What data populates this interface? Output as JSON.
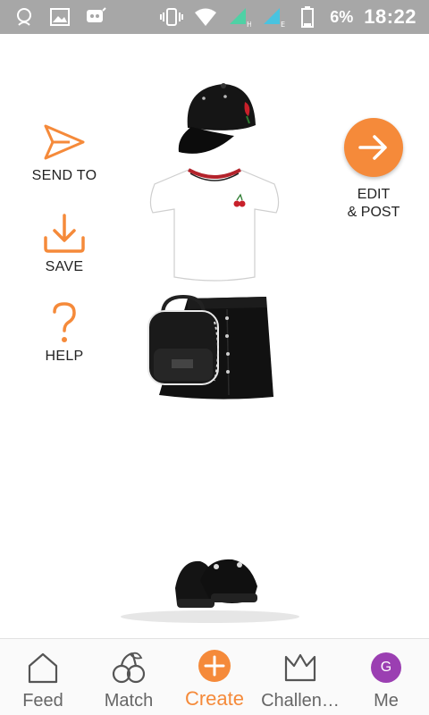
{
  "status_bar": {
    "battery_percent": "6%",
    "time": "18:22",
    "icons": [
      "app-notification-icon",
      "image-icon",
      "chat-bot-icon",
      "vibrate-icon",
      "wifi-icon",
      "signal-icon",
      "signal-icon-2",
      "battery-icon"
    ]
  },
  "actions": {
    "send_to": "SEND TO",
    "save": "SAVE",
    "help": "HELP"
  },
  "edit_post": {
    "line1": "EDIT",
    "line2": "& POST"
  },
  "outfit_items": [
    "black-cap",
    "white-crop-tee",
    "black-backpack",
    "black-mini-skirt",
    "black-platform-sneakers"
  ],
  "bottom_nav": {
    "feed": "Feed",
    "match": "Match",
    "create": "Create",
    "challenges": "Challen…",
    "me": "Me",
    "avatar_letter": "G",
    "active": "create"
  },
  "colors": {
    "accent": "#f58a3a",
    "status_bar": "#a7a7a7",
    "avatar": "#9b3fb2"
  }
}
